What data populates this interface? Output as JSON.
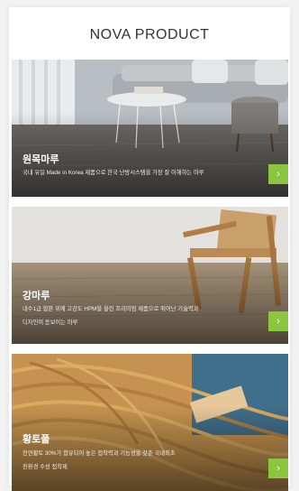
{
  "header": {
    "title": "NOVA PRODUCT"
  },
  "products": [
    {
      "title": "원목마루",
      "desc_lines": [
        "국내 유일 Made in Korea 제품으로 한국 난방시스템을 가장 잘 이해하는 마루"
      ],
      "arrow": "›",
      "icon": "chevron-right-icon"
    },
    {
      "title": "강마루",
      "desc_lines": [
        "내수1급 합판 위에 고강도 HPM을 올린 프리미엄 제품으로 뛰어난 기술력과",
        "디자인이 돋보이는 마루"
      ],
      "arrow": "›",
      "icon": "chevron-right-icon"
    },
    {
      "title": "황토풀",
      "desc_lines": [
        "천연황토 30%가 함유되어 높은 접착력과 기능성을 갖춘 국내최초",
        "친환경 수성 접착제"
      ],
      "arrow": "›",
      "icon": "chevron-right-icon"
    }
  ],
  "colors": {
    "accent": "#8cc63f",
    "heading": "#333333"
  }
}
